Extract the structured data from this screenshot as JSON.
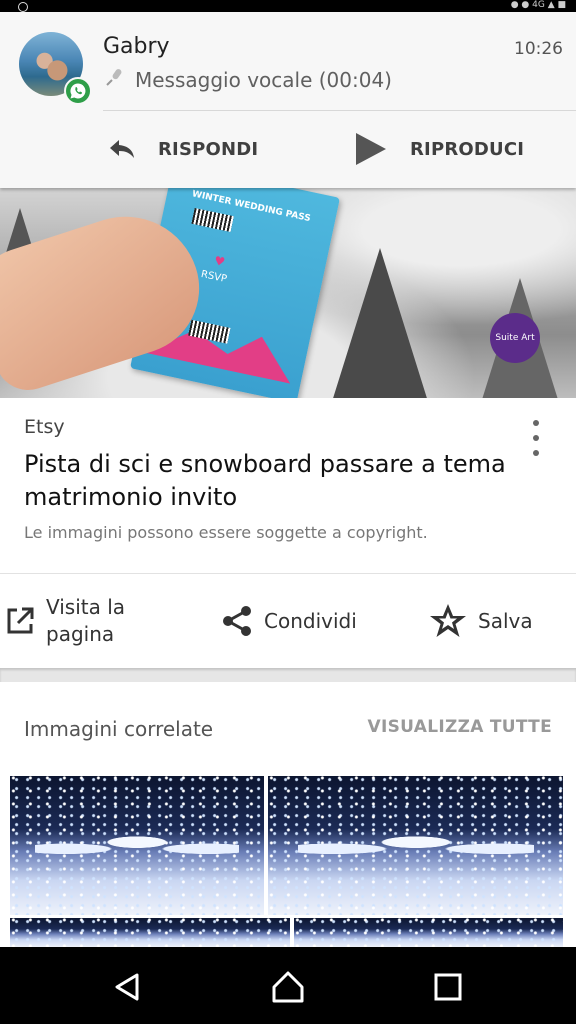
{
  "notification": {
    "sender": "Gabry",
    "time": "10:26",
    "message": "Messaggio vocale (00:04)",
    "reply_label": "RISPONDI",
    "play_label": "RIPRODUCI",
    "app_icon": "whatsapp-icon"
  },
  "result": {
    "source": "Etsy",
    "title": "Pista di sci e snowboard passare a tema matrimonio invito",
    "copyright_note": "Le immagini possono essere soggette a copyright.",
    "ticket_text": "WINTER WEDDING PASS",
    "ticket_rsvp": "RSVP",
    "logo_text": "Suite Art"
  },
  "actions": {
    "visit_label_line1": "Visita la",
    "visit_label_line2": "pagina",
    "share_label": "Condividi",
    "save_label": "Salva"
  },
  "related": {
    "heading": "Immagini correlate",
    "see_all": "VISUALIZZA TUTTE"
  },
  "navigation": {
    "back": "back-icon",
    "home": "home-icon",
    "recents": "recents-icon"
  },
  "colors": {
    "whatsapp_green": "#2e9e48",
    "background": "#ffffff",
    "notification_bg": "#f7f7f7"
  }
}
